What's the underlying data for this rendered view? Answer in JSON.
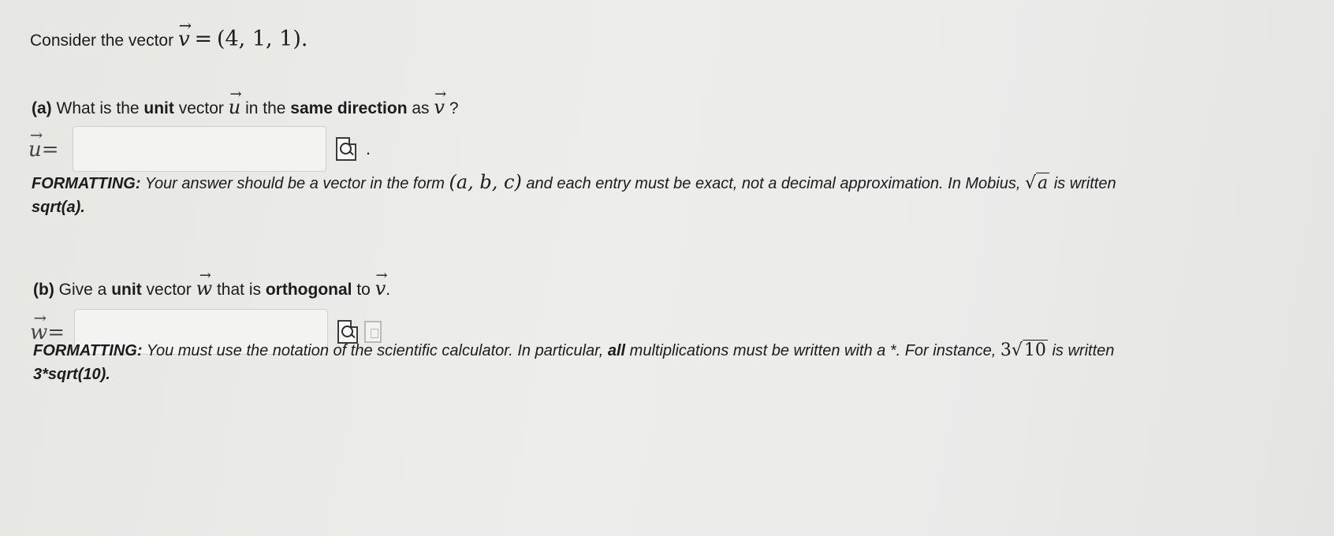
{
  "intro": {
    "text": "Consider the vector",
    "vector_symbol": "v",
    "equals": "=",
    "value": "(4, 1, 1)."
  },
  "part_a": {
    "label": "(a)",
    "text_1": "What is the",
    "bold_1": "unit",
    "text_2": "vector",
    "symbol_1": "u",
    "text_3": "in the",
    "bold_2": "same direction",
    "text_4": "as",
    "symbol_2": "v",
    "text_5": "?",
    "answer_var": "u",
    "answer_eq": "=",
    "answer_value": "",
    "trailing": ".",
    "formatting": {
      "head": "FORMATTING:",
      "text_1": "Your answer should be a vector in the form",
      "form": "(a, b, c)",
      "text_2": "and each entry must be exact, not a decimal approximation. In Mobius,",
      "sqrt_arg": "a",
      "text_3": "is written",
      "example": "sqrt(a)."
    }
  },
  "part_b": {
    "label": "(b)",
    "text_1": "Give a",
    "bold_1": "unit",
    "text_2": "vector",
    "symbol_1": "w",
    "text_3": "that is",
    "bold_2": "orthogonal",
    "text_4": "to",
    "symbol_2": "v",
    "text_5": ".",
    "answer_var": "w",
    "answer_eq": "=",
    "answer_value": "",
    "formatting": {
      "head": "FORMATTING:",
      "text_1": "You must use the notation of the scientific calculator. In particular,",
      "bold": "all",
      "text_2": "multiplications must be written with a *. For instance,",
      "coef": "3",
      "sqrt_arg": "10",
      "text_3": "is written",
      "example": "3*sqrt(10)."
    }
  },
  "icons": {
    "preview": "preview-icon",
    "calculator": "calculator-icon"
  }
}
